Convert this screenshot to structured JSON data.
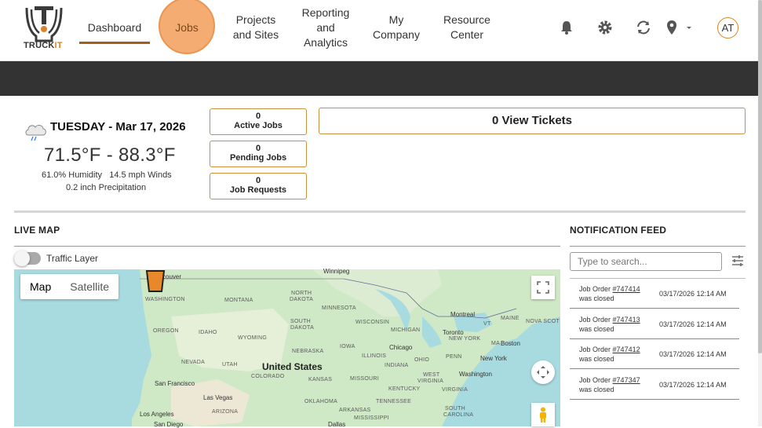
{
  "brand": {
    "logo_text_main": "TRUCK",
    "logo_text_accent": "IT",
    "accent_color": "#d9822b"
  },
  "nav": {
    "dashboard": "Dashboard",
    "jobs": "Jobs",
    "projects_l1": "Projects",
    "projects_l2": "and Sites",
    "reporting_l1": "Reporting",
    "reporting_l2": "and",
    "reporting_l3": "Analytics",
    "company_l1": "My",
    "company_l2": "Company",
    "resource_l1": "Resource",
    "resource_l2": "Center"
  },
  "header_icons": [
    "bell-icon",
    "gear-icon",
    "sync-icon",
    "location-pin-icon",
    "caret-down-icon"
  ],
  "user": {
    "initials": "AT"
  },
  "weather": {
    "date": "TUESDAY - Mar 17, 2026",
    "temp_range": "71.5°F - 88.3°F",
    "humidity_winds": "61.0% Humidity   14.5 mph Winds",
    "precipitation": "0.2 inch Precipitation"
  },
  "counts": {
    "active_value": "0",
    "active_label": "Active Jobs",
    "pending_value": "0",
    "pending_label": "Pending Jobs",
    "requests_value": "0",
    "requests_label": "Job Requests"
  },
  "tickets": {
    "label": "0 View Tickets"
  },
  "live_map": {
    "title": "LIVE MAP",
    "traffic_label": "Traffic Layer",
    "traffic_on": false,
    "map_tab": "Map",
    "satellite_tab": "Satellite",
    "labels": {
      "washington": "WASHINGTON",
      "oregon": "OREGON",
      "idaho": "IDAHO",
      "montana": "MONTANA",
      "wyoming": "WYOMING",
      "north_dakota_1": "NORTH",
      "north_dakota_2": "DAKOTA",
      "south_dakota_1": "SOUTH",
      "south_dakota_2": "DAKOTA",
      "minnesota": "MINNESOTA",
      "wisconsin": "WISCONSIN",
      "michigan": "MICHIGAN",
      "nebraska": "NEBRASKA",
      "iowa": "IOWA",
      "illinois": "ILLINOIS",
      "indiana": "INDIANA",
      "ohio": "OHIO",
      "penn": "PENN",
      "nevada": "NEVADA",
      "utah": "UTAH",
      "colorado": "COLORADO",
      "kansas": "KANSAS",
      "missouri": "MISSOURI",
      "kentucky": "KENTUCKY",
      "west_1": "WEST",
      "west_2": "VIRGINIA",
      "virginia": "VIRGINIA",
      "tennessee": "TENNESSEE",
      "oklahoma": "OKLAHOMA",
      "arkansas": "ARKANSAS",
      "arizona": "ARIZONA",
      "mississippi": "MISSISSIPPI",
      "south_carolina_1": "SOUTH",
      "south_carolina_2": "CAROLINA",
      "maine": "MAINE",
      "vt": "VT",
      "ma": "MA",
      "new_york": "NEW YORK",
      "nova_scotia": "NOVA SCOT",
      "country": "United States"
    },
    "cities": {
      "vancouver": "couver",
      "winnipeg": "Winnipeg",
      "montreal": "Montreal",
      "toronto": "Toronto",
      "boston": "Boston",
      "new_york": "New York",
      "chicago": "Chicago",
      "washington": "Washington",
      "san_francisco": "San Francisco",
      "las_vegas": "Las Vegas",
      "los_angeles": "Los Angeles",
      "san_diego": "San Diego",
      "dallas": "Dallas"
    }
  },
  "notifications": {
    "title": "NOTIFICATION FEED",
    "search_placeholder": "Type to search...",
    "items": [
      {
        "prefix": "Job Order",
        "order": "#747414",
        "status": "was closed",
        "time": "03/17/2026 12:14 AM"
      },
      {
        "prefix": "Job Order",
        "order": "#747413",
        "status": "was closed",
        "time": "03/17/2026 12:14 AM"
      },
      {
        "prefix": "Job Order",
        "order": "#747412",
        "status": "was closed",
        "time": "03/17/2026 12:14 AM"
      },
      {
        "prefix": "Job Order",
        "order": "#747347",
        "status": "was closed",
        "time": "03/17/2026 12:14 AM"
      }
    ]
  }
}
